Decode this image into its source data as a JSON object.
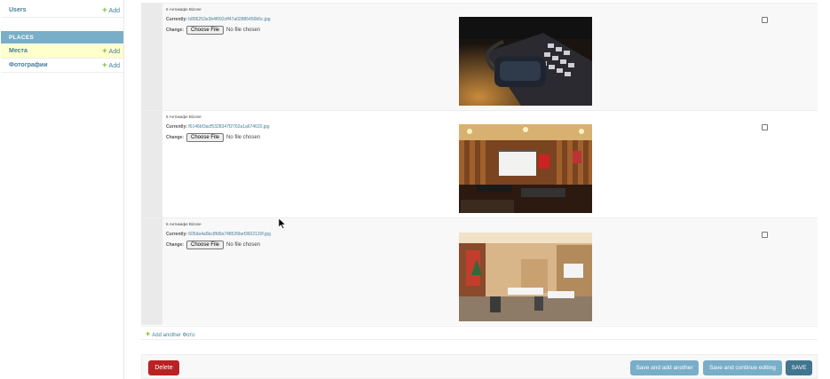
{
  "sidebar": {
    "users": {
      "label": "Users",
      "add_label": "Add"
    },
    "places_header": "PLACES",
    "places": {
      "label": "Места",
      "add_label": "Add"
    },
    "photos": {
      "label": "Фотографии",
      "add_label": "Add"
    }
  },
  "inlines": [
    {
      "title": "6 Антикафе Bizone",
      "currently_label": "Currently:",
      "file_name": "b896253e3b4f092cff47a02885450b5c.jpg",
      "change_label": "Change:",
      "choose_file": "Choose File",
      "no_file": "No file chosen",
      "photo": "vr-headset-on-keyboard"
    },
    {
      "title": "6 Антикафе Bizone",
      "currently_label": "Currently:",
      "file_name": "f6146bf3acf5328347f2762a1a674620.jpg",
      "change_label": "Change:",
      "choose_file": "Choose File",
      "no_file": "No file chosen",
      "photo": "cafe-room-with-projector"
    },
    {
      "title": "6 Антикафе Bizone",
      "currently_label": "Currently:",
      "file_name": "605da4a5bc8fd9a748526bef3602120f.jpg",
      "change_label": "Change:",
      "choose_file": "Choose File",
      "no_file": "No file chosen",
      "photo": "cafe-room-with-tables"
    }
  ],
  "add_another": "Add another Фото",
  "submit_row": {
    "delete": "Delete",
    "save_add_another": "Save and add another",
    "save_continue": "Save and continue editing",
    "save": "SAVE"
  },
  "colors": {
    "link": "#447e9b",
    "header_bg": "#79aec8",
    "delete_bg": "#ba2121",
    "save_bg": "#417690",
    "highlight_row": "#ffffcc"
  }
}
